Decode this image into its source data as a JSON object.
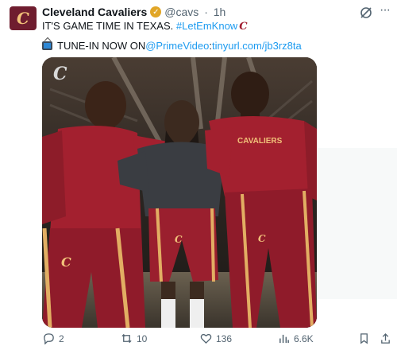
{
  "tweet": {
    "avatar_text": "C",
    "author": "Cleveland Cavaliers",
    "handle": "@cavs",
    "separator": "·",
    "time": "1h",
    "line1_text": "IT'S GAME TIME IN TEXAS. ",
    "line1_hashtag": "#LetEmKnow",
    "line1_emoji": "C",
    "line2_prefix": " TUNE-IN NOW ON ",
    "line2_mention": "@PrimeVideo",
    "line2_colon": ": ",
    "line2_link": "tinyurl.com/jb3rz8ta"
  },
  "media": {
    "logo": "C",
    "jersey_text": "CAVALIERS"
  },
  "actions": {
    "replies": "2",
    "reposts": "10",
    "likes": "136",
    "views": "6.6K"
  },
  "colors": {
    "cavs_wine": "#6f1d2f",
    "jersey_red": "#a0202f",
    "link_blue": "#1d9bf0",
    "muted": "#536471"
  },
  "icons": [
    "verified-badge-icon",
    "grok-icon",
    "more-icon",
    "tv-icon",
    "reply-icon",
    "repost-icon",
    "like-icon",
    "views-icon",
    "bookmark-icon",
    "share-icon"
  ]
}
